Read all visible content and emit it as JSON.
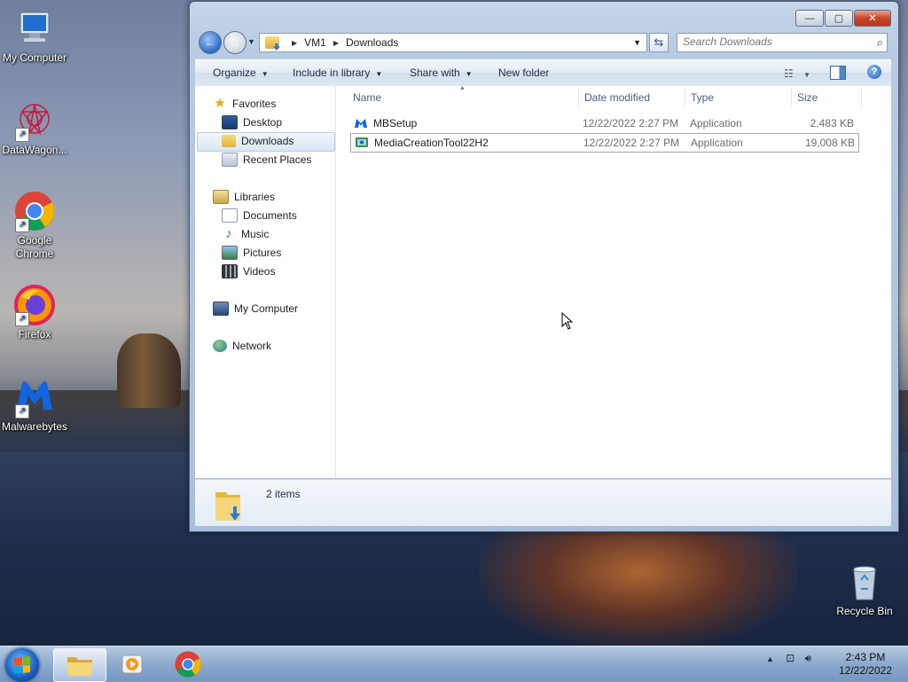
{
  "desktop": {
    "icons": [
      {
        "label": "My Computer"
      },
      {
        "label": "DataWagon..."
      },
      {
        "label": "Google Chrome"
      },
      {
        "label": "Firefox"
      },
      {
        "label": "Malwarebytes"
      },
      {
        "label": "Recycle Bin"
      }
    ]
  },
  "window": {
    "controls": {
      "minimize": "—",
      "maximize": "▢",
      "close": "✕"
    },
    "address": {
      "crumbs": [
        "VM1",
        "Downloads"
      ]
    },
    "search": {
      "placeholder": "Search Downloads"
    },
    "toolbar": {
      "organize": "Organize",
      "include_in_library": "Include in library",
      "share_with": "Share with",
      "new_folder": "New folder"
    },
    "nav": {
      "favorites": "Favorites",
      "desktop": "Desktop",
      "downloads": "Downloads",
      "recent_places": "Recent Places",
      "libraries": "Libraries",
      "documents": "Documents",
      "music": "Music",
      "pictures": "Pictures",
      "videos": "Videos",
      "my_computer": "My Computer",
      "network": "Network",
      "selected": "Downloads"
    },
    "columns": {
      "name": "Name",
      "date_modified": "Date modified",
      "type": "Type",
      "size": "Size"
    },
    "files": [
      {
        "name": "MBSetup",
        "date": "12/22/2022 2:27 PM",
        "type": "Application",
        "size": "2,483 KB"
      },
      {
        "name": "MediaCreationTool22H2",
        "date": "12/22/2022 2:27 PM",
        "type": "Application",
        "size": "19,008 KB",
        "selected": true
      }
    ],
    "details": {
      "count": "2 items"
    }
  },
  "taskbar": {
    "clock": {
      "time": "2:43 PM",
      "date": "12/22/2022"
    }
  },
  "colors": {
    "accent": "#2d6ac6",
    "selection_border": "#a5a5a5"
  }
}
